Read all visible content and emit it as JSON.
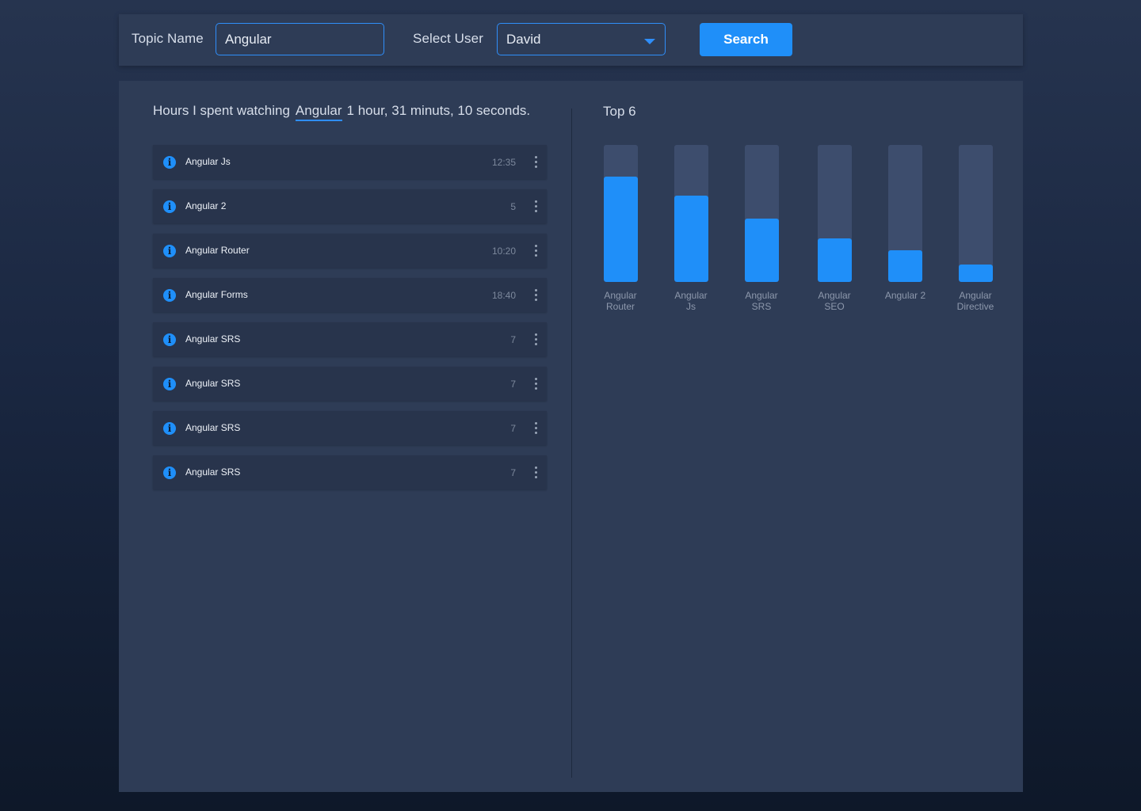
{
  "topbar": {
    "topic_label": "Topic Name",
    "topic_value": "Angular",
    "user_label": "Select User",
    "user_value": "David",
    "search_label": "Search"
  },
  "summary": {
    "prefix": "Hours I spent watching",
    "topic": "Angular",
    "duration": "1 hour, 31 minuts, 10 seconds."
  },
  "list": {
    "items": [
      {
        "title": "Angular Js",
        "duration": "12:35"
      },
      {
        "title": "Angular 2",
        "duration": "5"
      },
      {
        "title": "Angular Router",
        "duration": "10:20"
      },
      {
        "title": "Angular Forms",
        "duration": "18:40"
      },
      {
        "title": "Angular SRS",
        "duration": "7"
      },
      {
        "title": "Angular SRS",
        "duration": "7"
      },
      {
        "title": "Angular SRS",
        "duration": "7"
      },
      {
        "title": "Angular SRS",
        "duration": "7"
      }
    ]
  },
  "chart_data": {
    "type": "bar",
    "title": "Top 6",
    "categories": [
      "Angular Router",
      "Angular Js",
      "Angular SRS",
      "Angular SEO",
      "Angular 2",
      "Angular Directive"
    ],
    "values": [
      77,
      63,
      46,
      32,
      23,
      13
    ],
    "ylim": [
      0,
      100
    ],
    "units": "percent of bar filled",
    "grid": false
  },
  "colors": {
    "accent": "#1f8ff9",
    "panel": "#2e3c56",
    "row": "#28344c",
    "bar_track": "#3d4d6d"
  },
  "icons": {
    "row_icon": "info-icon",
    "row_menu": "more-vertical-icon",
    "select_caret": "caret-down-icon"
  }
}
